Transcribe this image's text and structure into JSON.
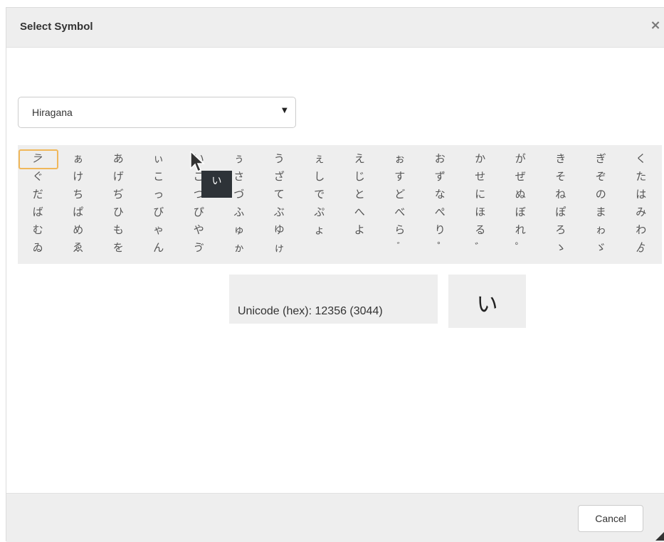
{
  "dialog": {
    "title": "Select Symbol",
    "close_glyph": "×"
  },
  "select": {
    "value": "Hiragana",
    "arrow": "▼"
  },
  "grid": {
    "selected_index": 0,
    "hovered_index": 4,
    "cells": [
      "𛀀",
      "ぁ",
      "あ",
      "ぃ",
      "い",
      "ぅ",
      "う",
      "ぇ",
      "え",
      "ぉ",
      "お",
      "か",
      "が",
      "き",
      "ぎ",
      "く",
      "ぐ",
      "け",
      "げ",
      "こ",
      "ご",
      "さ",
      "ざ",
      "し",
      "じ",
      "す",
      "ず",
      "せ",
      "ぜ",
      "そ",
      "ぞ",
      "た",
      "だ",
      "ち",
      "ぢ",
      "っ",
      "つ",
      "づ",
      "て",
      "で",
      "と",
      "ど",
      "な",
      "に",
      "ぬ",
      "ね",
      "の",
      "は",
      "ば",
      "ぱ",
      "ひ",
      "び",
      "ぴ",
      "ふ",
      "ぶ",
      "ぷ",
      "へ",
      "べ",
      "ぺ",
      "ほ",
      "ぼ",
      "ぽ",
      "ま",
      "み",
      "む",
      "め",
      "も",
      "ゃ",
      "や",
      "ゅ",
      "ゆ",
      "ょ",
      "よ",
      "ら",
      "り",
      "る",
      "れ",
      "ろ",
      "ゎ",
      "わ",
      "ゐ",
      "ゑ",
      "を",
      "ん",
      "ゔ",
      "ゕ",
      "ゖ",
      "",
      "",
      "゙",
      "゚",
      "゛",
      "゜",
      "ゝ",
      "ゞ",
      "ゟ"
    ]
  },
  "tooltip": {
    "text": "い"
  },
  "info": {
    "unicode_text": "Unicode (hex): 12356 (3044)"
  },
  "preview": {
    "glyph": "い"
  },
  "footer": {
    "cancel_label": "Cancel"
  },
  "colors": {
    "header_bg": "#eeeeee",
    "selected_outline": "#f0b75a",
    "tooltip_bg": "#2e3338"
  }
}
